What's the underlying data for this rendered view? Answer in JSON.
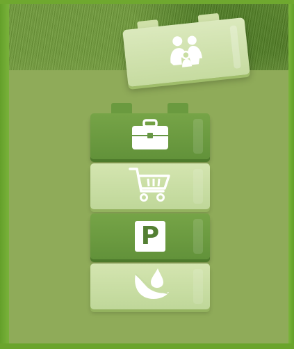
{
  "screen": {
    "top_category": {
      "icon": "family-icon"
    },
    "categories": [
      {
        "icon": "briefcase-icon",
        "style": "dark"
      },
      {
        "icon": "shopping-cart-icon",
        "style": "light"
      },
      {
        "icon": "parking-sign-icon",
        "style": "dark",
        "label": "P"
      },
      {
        "icon": "leaf-water-drop-icon",
        "style": "light"
      }
    ]
  },
  "colors": {
    "frame": "#6fa82f",
    "panel": "#8fab59",
    "block_dark": "#6a9a3f",
    "block_light": "#cfe0a8"
  }
}
